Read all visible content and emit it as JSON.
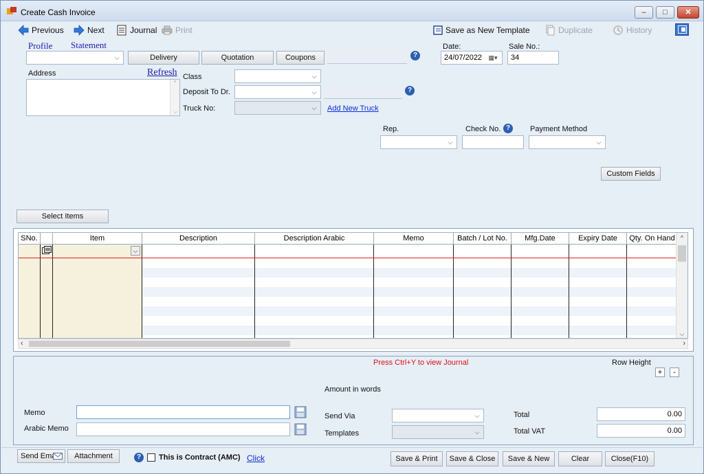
{
  "window": {
    "title": "Create Cash Invoice",
    "min": "–",
    "max": "□",
    "close": "✕"
  },
  "toolbar": {
    "previous": "Previous",
    "next": "Next",
    "journal": "Journal",
    "print": "Print",
    "save_template": "Save as New Template",
    "duplicate": "Duplicate",
    "history": "History"
  },
  "header": {
    "profile": "Profile",
    "statement": "Statement",
    "delivery": "Delivery",
    "quotation": "Quotation",
    "coupons": "Coupons",
    "address": "Address",
    "refresh": "Refresh",
    "class": "Class",
    "deposit_to": "Deposit To Dr.",
    "truck_no": "Truck No:",
    "add_new_truck": "Add New Truck",
    "date_label": "Date:",
    "date_value": "24/07/2022",
    "sale_no_label": "Sale No.:",
    "sale_no_value": "34",
    "rep": "Rep.",
    "check_no": "Check No.",
    "payment_method": "Payment Method",
    "custom_fields": "Custom Fields"
  },
  "items": {
    "select_items": "Select Items",
    "columns": [
      "SNo.",
      "",
      "Item",
      "Description",
      "Description Arabic",
      "Memo",
      "Batch / Lot No.",
      "Mfg.Date",
      "Expiry Date",
      "Qty. On Hand"
    ]
  },
  "bottom": {
    "journal_hint": "Press Ctrl+Y to view Journal",
    "row_height": "Row Height",
    "plus": "+",
    "minus": "-",
    "amount_in_words": "Amount in words",
    "memo": "Memo",
    "arabic_memo": "Arabic Memo",
    "send_via": "Send Via",
    "templates": "Templates",
    "total": "Total",
    "total_value": "0.00",
    "total_vat": "Total VAT",
    "total_vat_value": "0.00"
  },
  "footer": {
    "send_email": "Send Email",
    "attachment": "Attachment",
    "contract": "This is Contract (AMC)",
    "click": "Click",
    "save_print": "Save & Print",
    "save_close": "Save & Close",
    "save_new": "Save & New",
    "clear": "Clear",
    "close": "Close(F10)"
  },
  "colors": {
    "accent": "#2d5fb0",
    "link": "#0a2fd4",
    "red": "#e01010",
    "item_col": "#f5f1dc"
  }
}
